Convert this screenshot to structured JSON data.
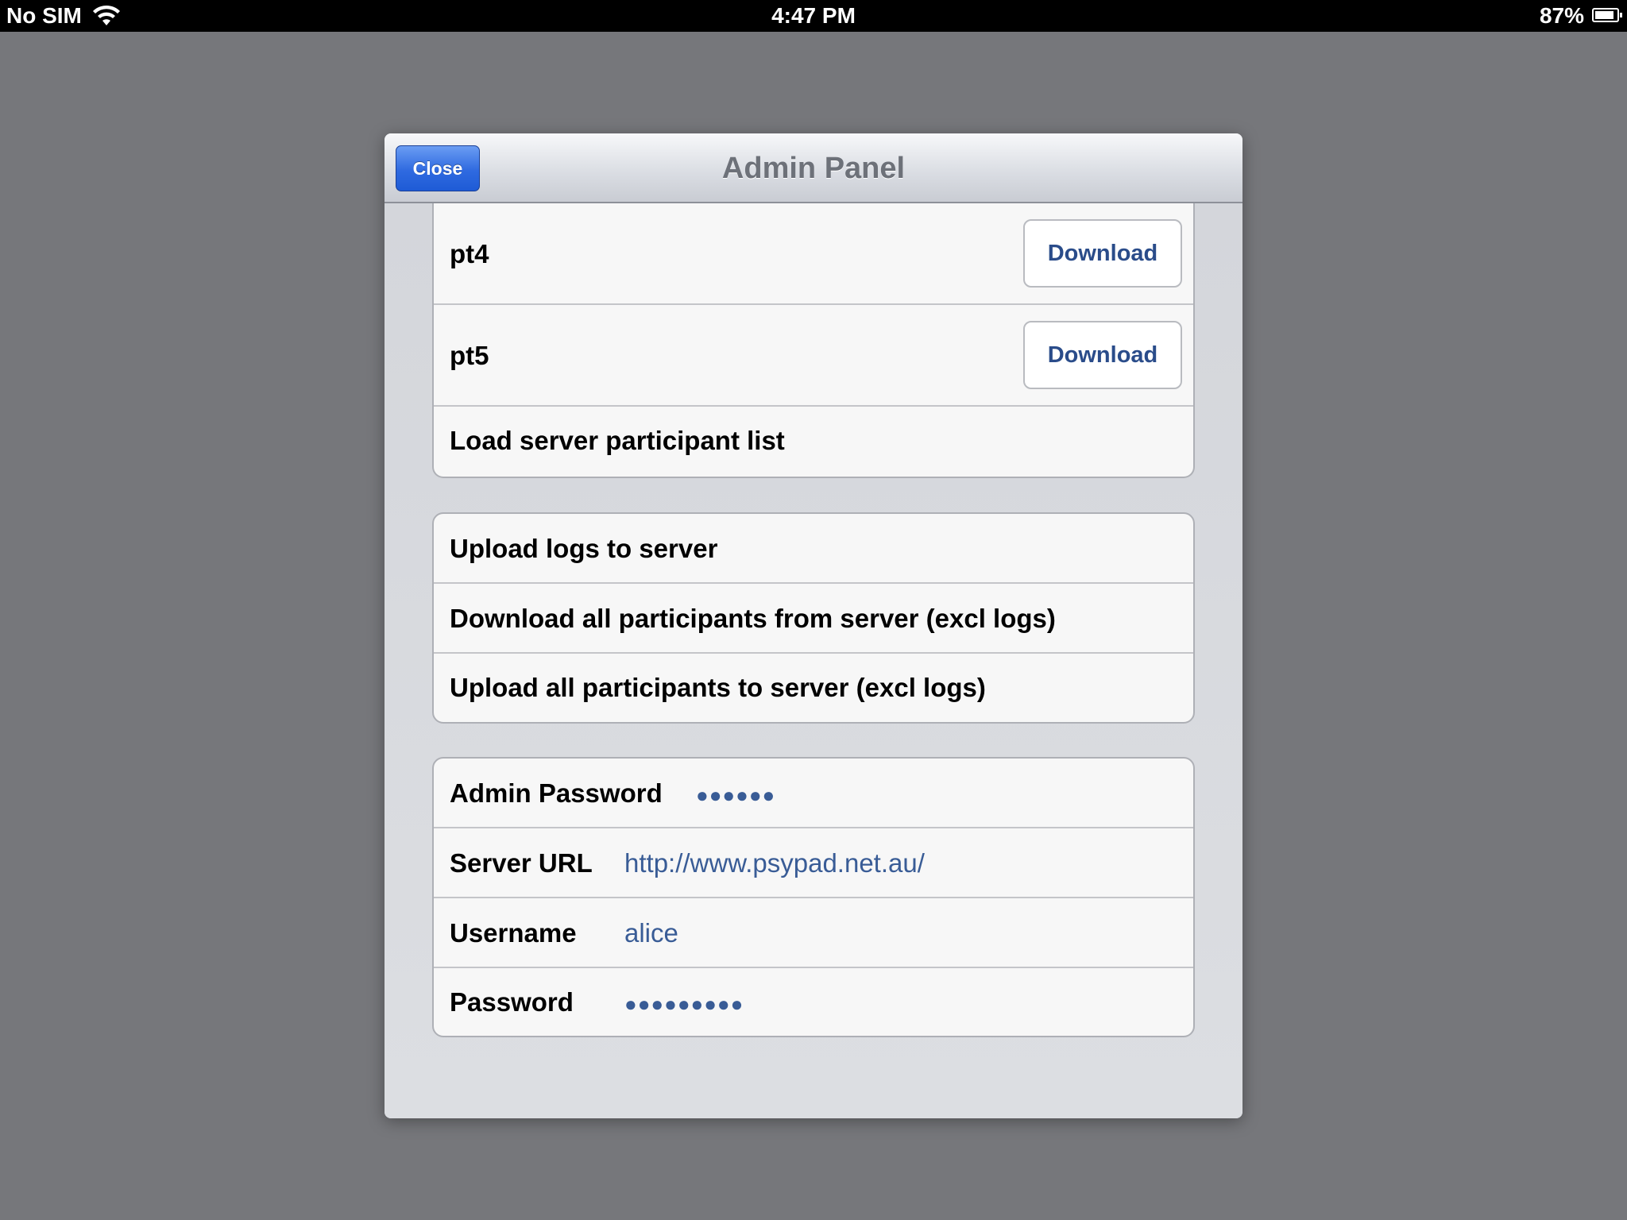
{
  "status_bar": {
    "carrier": "No SIM",
    "time": "4:47 PM",
    "battery_percent": "87%",
    "battery_level": 0.87
  },
  "modal": {
    "title": "Admin Panel",
    "close_label": "Close",
    "participants": [
      {
        "name": "pt4",
        "action": "Download"
      },
      {
        "name": "pt5",
        "action": "Download"
      }
    ],
    "load_list_label": "Load server participant list",
    "server_actions": [
      "Upload logs to server",
      "Download all participants from server (excl logs)",
      "Upload all participants to server (excl logs)"
    ],
    "settings": {
      "admin_password_label": "Admin Password",
      "admin_password_value": "●●●●●●",
      "server_url_label": "Server URL",
      "server_url_value": "http://www.psypad.net.au/",
      "username_label": "Username",
      "username_value": "alice",
      "password_label": "Password",
      "password_value": "●●●●●●●●●"
    }
  },
  "colors": {
    "accent_blue": "#2f6ae0",
    "value_text": "#395c96",
    "backdrop": "#76777b"
  }
}
